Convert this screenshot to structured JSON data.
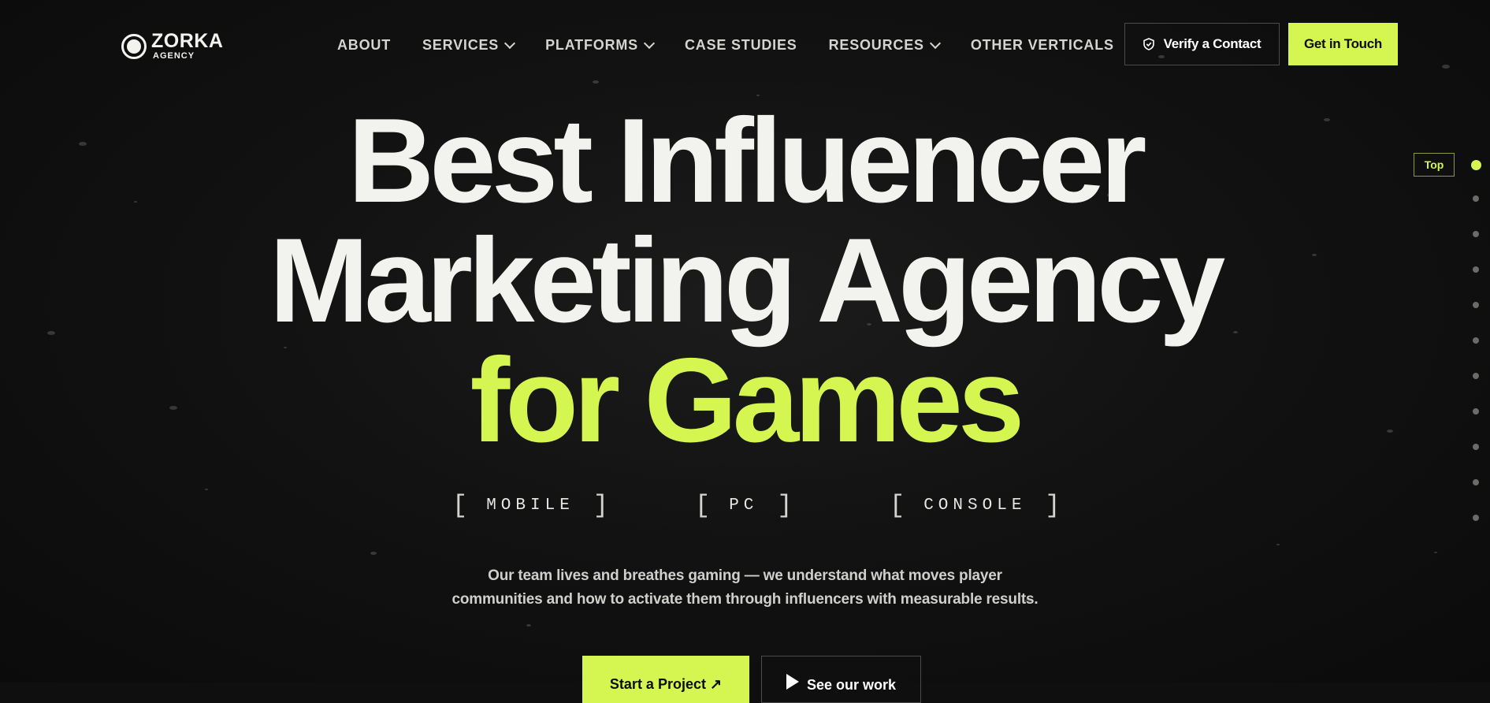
{
  "brand": {
    "name": "ZORKA",
    "sub": "AGENCY"
  },
  "nav": {
    "about": "ABOUT",
    "services": "SERVICES",
    "platforms": "PLATFORMS",
    "case_studies": "CASE STUDIES",
    "resources": "RESOURCES",
    "other_verticals": "OTHER VERTICALS"
  },
  "header": {
    "verify_label": "Verify a Contact",
    "contact_label": "Get in Touch"
  },
  "hero": {
    "line1": "Best Influencer",
    "line2": "Marketing Agency",
    "line3": "for Games",
    "platforms": [
      "MOBILE",
      "PC",
      "CONSOLE"
    ],
    "desc_line1": "Our team lives and breathes gaming — we understand what moves player",
    "desc_line2": "communities and how to activate them through influencers with measurable results.",
    "cta_primary": "Start a Project ↗",
    "cta_secondary": "See our work"
  },
  "rail": {
    "top_label": "Top",
    "sections": 11,
    "active": 1
  },
  "colors": {
    "accent": "#d5f550",
    "background": "#0f0f0f",
    "text": "#f2f2ee"
  },
  "icons": {
    "verify": "shield-check-icon",
    "dropdown": "chevron-down-icon",
    "play": "play-icon"
  }
}
